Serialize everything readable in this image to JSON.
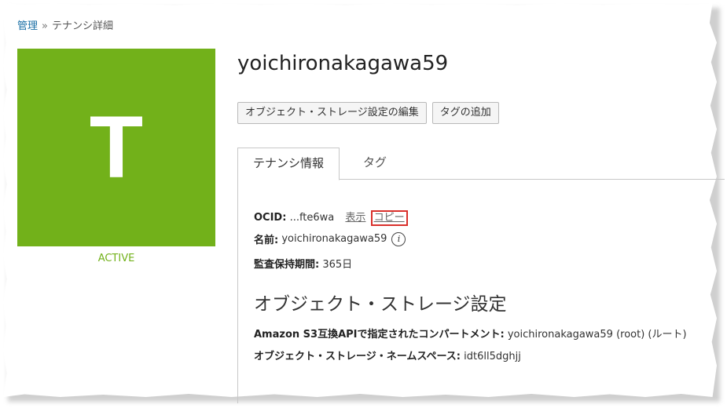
{
  "breadcrumb": {
    "parent": "管理",
    "separator": "»",
    "current": "テナンシ詳細"
  },
  "avatar": {
    "letter": "T",
    "color": "#72b11a"
  },
  "status": "ACTIVE",
  "tenancy_name": "yoichironakagawa59",
  "actions": {
    "edit_storage": "オブジェクト・ストレージ設定の編集",
    "add_tag": "タグの追加"
  },
  "tabs": {
    "info": "テナンシ情報",
    "tags": "タグ"
  },
  "details": {
    "ocid_label": "OCID:",
    "ocid_value": "...fte6wa",
    "show": "表示",
    "copy": "コピー",
    "name_label": "名前:",
    "name_value": "yoichironakagawa59",
    "retention_label": "監査保持期間:",
    "retention_value": "365日"
  },
  "storage": {
    "title": "オブジェクト・ストレージ設定",
    "s3_label": "Amazon S3互換APIで指定されたコンパートメント:",
    "s3_value": "yoichironakagawa59 (root) (ルート)",
    "namespace_label": "オブジェクト・ストレージ・ネームスペース:",
    "namespace_value": "idt6ll5dghjj"
  },
  "colors": {
    "accent": "#72b11a",
    "link": "#1a6fa5",
    "highlight": "#d9302b"
  }
}
